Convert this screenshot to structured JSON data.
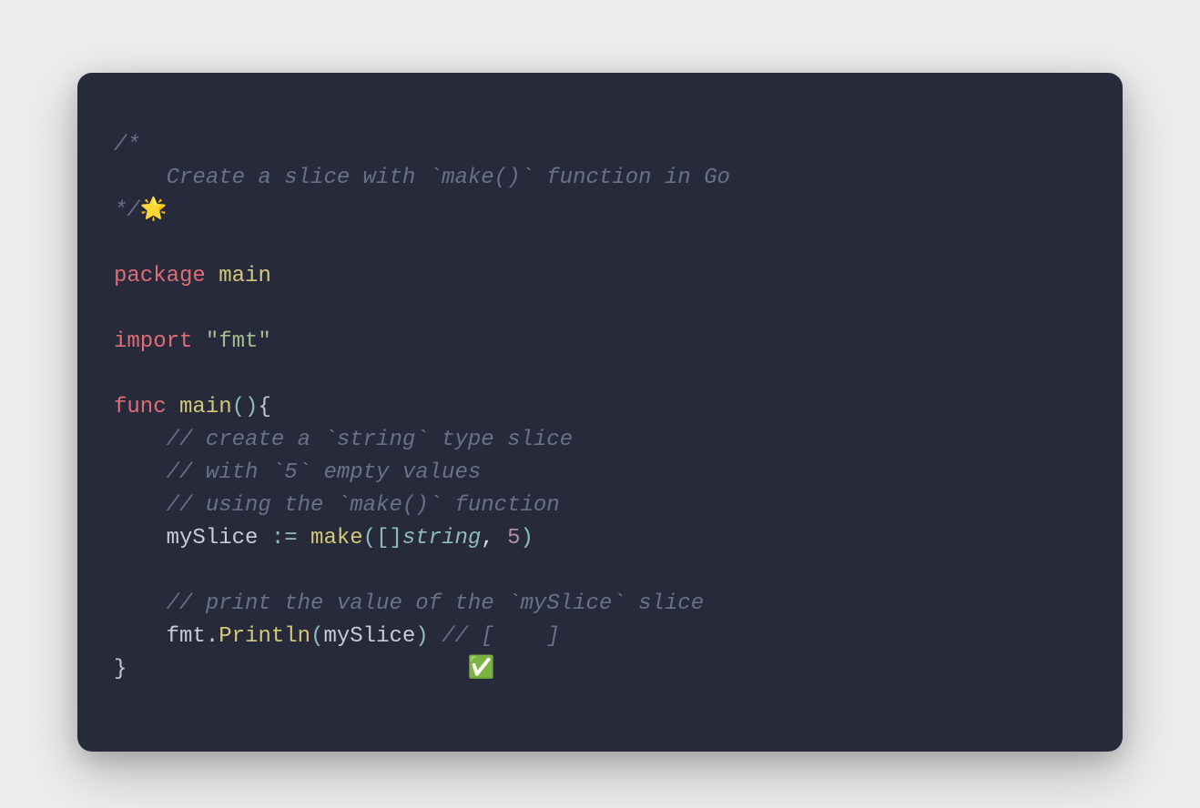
{
  "code": {
    "comment_block_open": "/*",
    "comment_line1": "    Create a slice with `make()` function in Go",
    "comment_block_close": "*/",
    "emoji_sparkle": "🌟",
    "blank": "",
    "package_keyword": "package",
    "package_name": " main",
    "import_keyword": "import",
    "import_value": " \"fmt\"",
    "func_keyword": "func",
    "main_name": " main",
    "open_paren": "(",
    "close_paren": ")",
    "open_brace": "{",
    "close_brace": "}",
    "indent": "    ",
    "comment_inline1": "// create a `string` type slice",
    "comment_inline2": "// with `5` empty values",
    "comment_inline3": "// using the `make()` function",
    "var_name": "mySlice",
    "assign_op": " := ",
    "make_call": "make",
    "bracket_open": "(",
    "slice_open": "[",
    "slice_close": "]",
    "type_string": "string",
    "comma_space": ", ",
    "number_5": "5",
    "bracket_close": ")",
    "comment_inline4": "// print the value of the `mySlice` slice",
    "fmt_ident": "fmt",
    "dot": ".",
    "println": "Println",
    "print_arg": "mySlice",
    "comment_output": " // [    ]",
    "emoji_check": "✅",
    "check_spacing": "                          "
  }
}
